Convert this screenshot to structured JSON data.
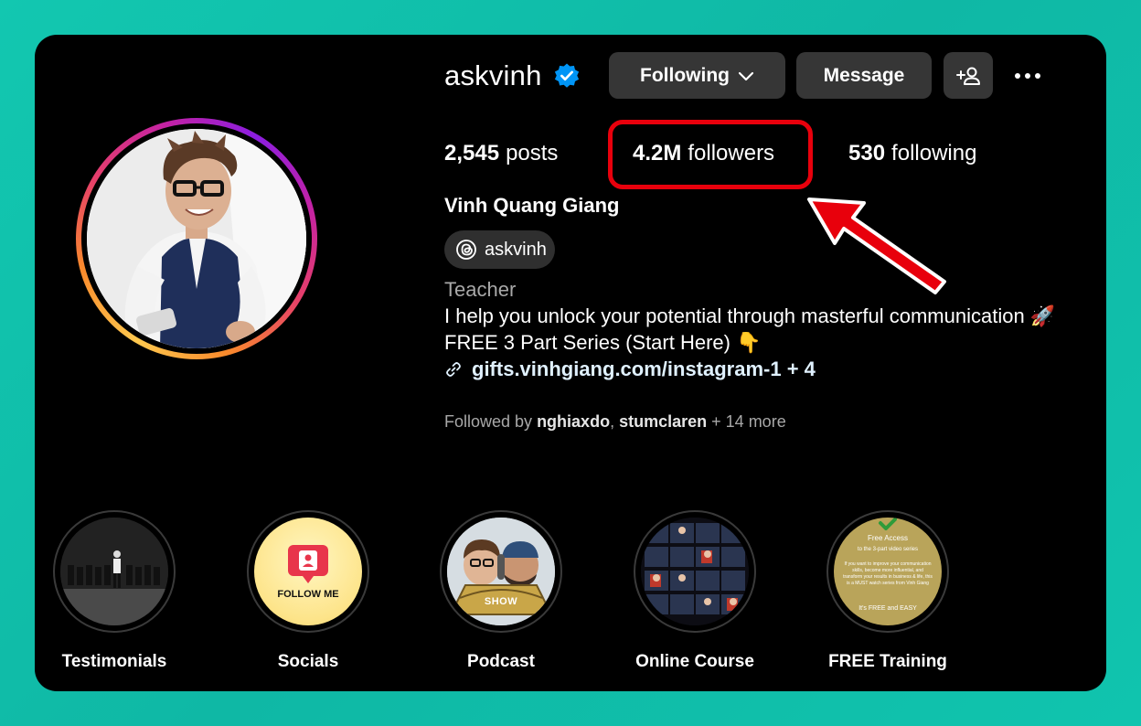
{
  "profile": {
    "username": "askvinh",
    "full_name": "Vinh Quang Giang",
    "threads_handle": "askvinh",
    "category": "Teacher",
    "bio_line1": "I help you unlock your potential through masterful communication 🚀",
    "bio_line2": "FREE 3 Part Series (Start Here) 👇",
    "link": "gifts.vinhgiang.com/instagram-1 + 4"
  },
  "actions": {
    "following_label": "Following",
    "message_label": "Message"
  },
  "stats": {
    "posts_count": "2,545",
    "posts_label": "posts",
    "followers_count": "4.2M",
    "followers_label": "followers",
    "following_count": "530",
    "following_label": "following"
  },
  "followed_by": {
    "prefix": "Followed by",
    "user1": "nghiaxdo",
    "separator": ",",
    "user2": "stumclaren",
    "more": "+ 14 more"
  },
  "highlights": [
    {
      "label": "Testimonials"
    },
    {
      "label": "Socials",
      "cover_text": "FOLLOW ME"
    },
    {
      "label": "Podcast",
      "cover_text": "SHOW"
    },
    {
      "label": "Online Course"
    },
    {
      "label": "FREE Training",
      "cover_title": "Free Access",
      "cover_subtitle": "to the 3-part video series",
      "cover_body": "If you want to improve your communication skills, become more influential, and transform your results in business & life, this is a MUST watch series from Vinh Giang",
      "cover_footer": "It's FREE and EASY"
    }
  ],
  "colors": {
    "background": "#12c7b0",
    "card": "#000000",
    "button": "#363636",
    "highlight_box": "#e8000c",
    "verified": "#0095f6",
    "muted_text": "#a8a8a8",
    "link": "#e0f1ff"
  },
  "icons": {
    "verified": "verified-badge-icon",
    "dropdown": "chevron-down-icon",
    "add_user": "add-user-icon",
    "more": "more-dots-icon",
    "threads": "threads-icon",
    "link": "link-icon",
    "annotation": "red-arrow-icon"
  }
}
